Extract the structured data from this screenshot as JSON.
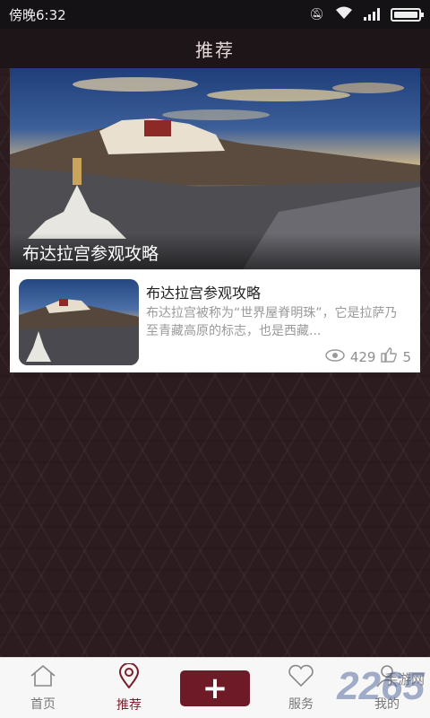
{
  "status_bar": {
    "time": "傍晚6:32"
  },
  "header": {
    "title": "推荐"
  },
  "featured": {
    "caption": "布达拉宫参观攻略"
  },
  "article": {
    "title": "布达拉宫参观攻略",
    "summary": "布达拉宫被称为“世界屋脊明珠”，它是拉萨乃至青藏高原的标志，也是西藏...",
    "views": "429",
    "likes": "5"
  },
  "tabbar": {
    "tabs": [
      {
        "label": "首页",
        "icon": "home-icon"
      },
      {
        "label": "推荐",
        "icon": "location-pin-icon",
        "active": true
      },
      {
        "label": "",
        "icon": "plus-icon"
      },
      {
        "label": "服务",
        "icon": "heart-icon"
      },
      {
        "label": "我的",
        "icon": "person-icon"
      }
    ]
  },
  "watermark": {
    "logo": "2265",
    "site": "手游网"
  },
  "colors": {
    "accent": "#7b1f2c",
    "plus_button": "#6e1b27",
    "background": "#2c1c1f"
  }
}
